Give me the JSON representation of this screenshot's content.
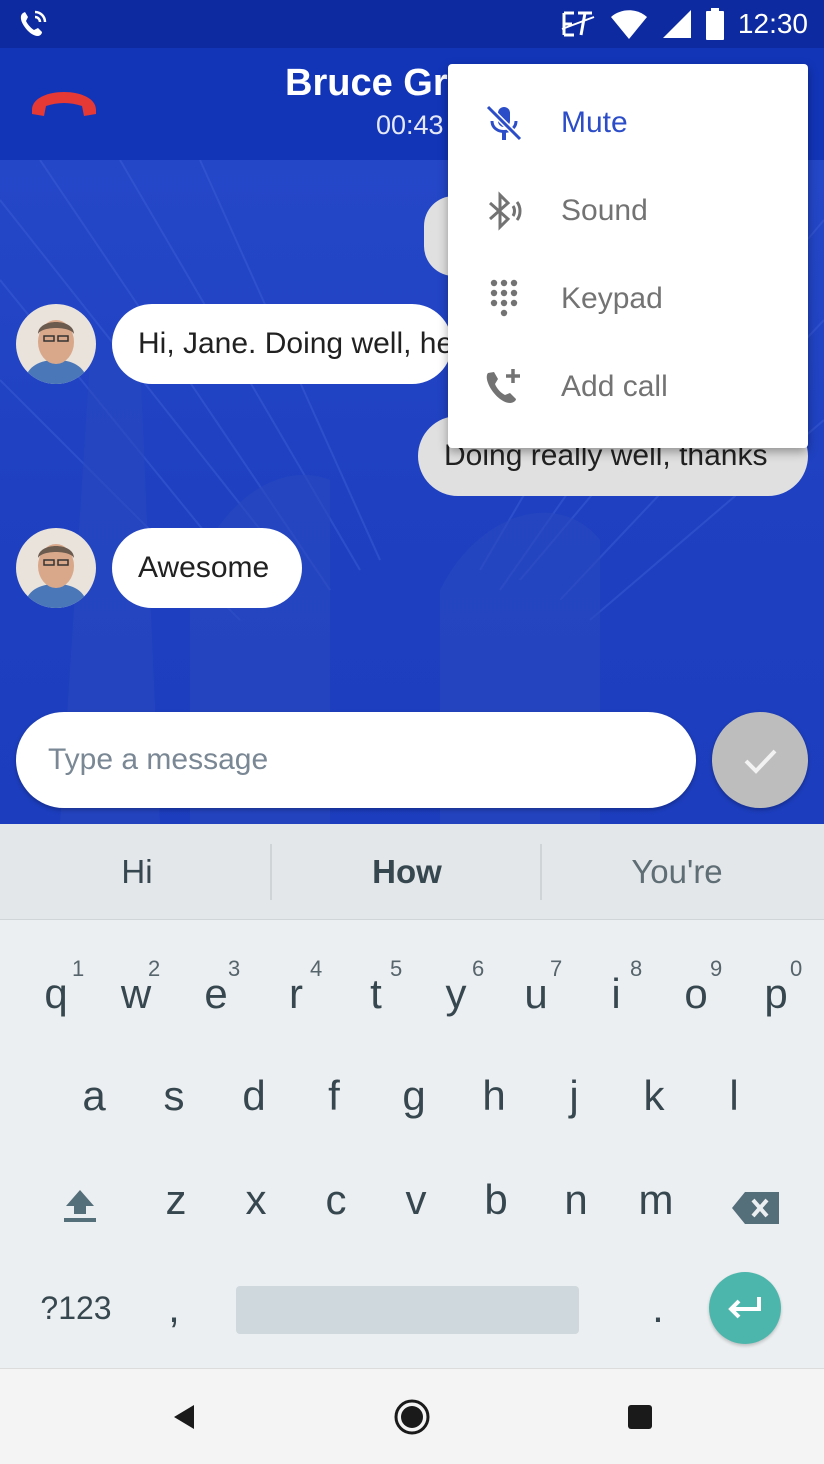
{
  "status_bar": {
    "time": "12:30",
    "icons": [
      "call-in-progress-icon",
      "text-relay-icon",
      "wifi-icon",
      "signal-icon",
      "battery-icon"
    ]
  },
  "call": {
    "contact_name": "Bruce Gra",
    "duration": "00:43"
  },
  "menu": {
    "items": [
      {
        "label": "Mute",
        "icon": "mic-off-icon"
      },
      {
        "label": "Sound",
        "icon": "bluetooth-audio-icon"
      },
      {
        "label": "Keypad",
        "icon": "dialpad-icon"
      },
      {
        "label": "Add call",
        "icon": "add-call-icon"
      }
    ]
  },
  "messages": [
    {
      "from": "contact",
      "text": "Hi, Jane. Doing well, he"
    },
    {
      "from": "me",
      "text": "Doing really well, thanks"
    },
    {
      "from": "contact",
      "text": "Awesome"
    }
  ],
  "composer": {
    "placeholder": "Type a message"
  },
  "keyboard": {
    "suggestions": [
      "Hi",
      "How",
      "You're"
    ],
    "row1": [
      "q",
      "w",
      "e",
      "r",
      "t",
      "y",
      "u",
      "i",
      "o",
      "p"
    ],
    "row1_hints": [
      "1",
      "2",
      "3",
      "4",
      "5",
      "6",
      "7",
      "8",
      "9",
      "0"
    ],
    "row2": [
      "a",
      "s",
      "d",
      "f",
      "g",
      "h",
      "j",
      "k",
      "l"
    ],
    "row3": [
      "z",
      "x",
      "c",
      "v",
      "b",
      "n",
      "m"
    ],
    "symbols_label": "?123",
    "comma": ",",
    "period": "."
  },
  "colors": {
    "accent": "#2c4dc8",
    "call_bar": "#1235b8",
    "status_bar": "#0d2aa0",
    "hangup": "#e53935",
    "enter_key": "#4db6ac"
  }
}
